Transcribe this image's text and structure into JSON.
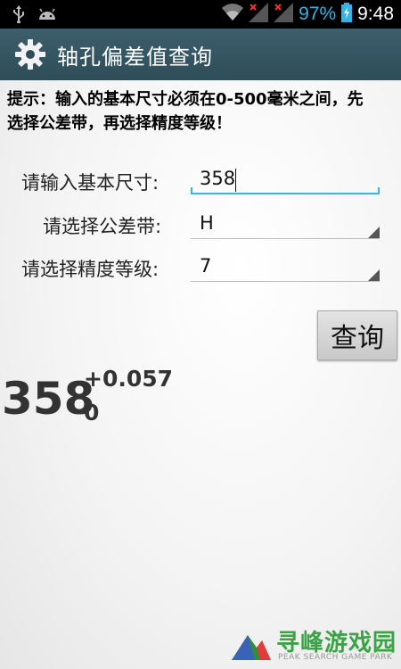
{
  "status_bar": {
    "battery_percent": "97%",
    "time": "9:48",
    "icons": [
      "usb-icon",
      "android-icon",
      "wifi-icon",
      "signal-icon",
      "signal-icon",
      "battery-charging-icon"
    ],
    "accent": "#33b5e5"
  },
  "action_bar": {
    "title": "轴孔偏差值查询",
    "icon": "gear-icon",
    "color": "#2e4d59"
  },
  "hint": "提示：输入的基本尺寸必须在0-500毫米之间，先选择公差带，再选择精度等级！",
  "form": {
    "size_label": "请输入基本尺寸:",
    "size_value": "358",
    "tolerance_label": "请选择公差带:",
    "tolerance_value": "H",
    "grade_label": "请选择精度等级:",
    "grade_value": "7"
  },
  "query_button": "查询",
  "result": {
    "base": "358",
    "upper": "+0.057",
    "lower": "0"
  },
  "watermark": {
    "title": "寻峰游戏园",
    "subtitle": "PEAK SEARCH GAME PARK"
  }
}
